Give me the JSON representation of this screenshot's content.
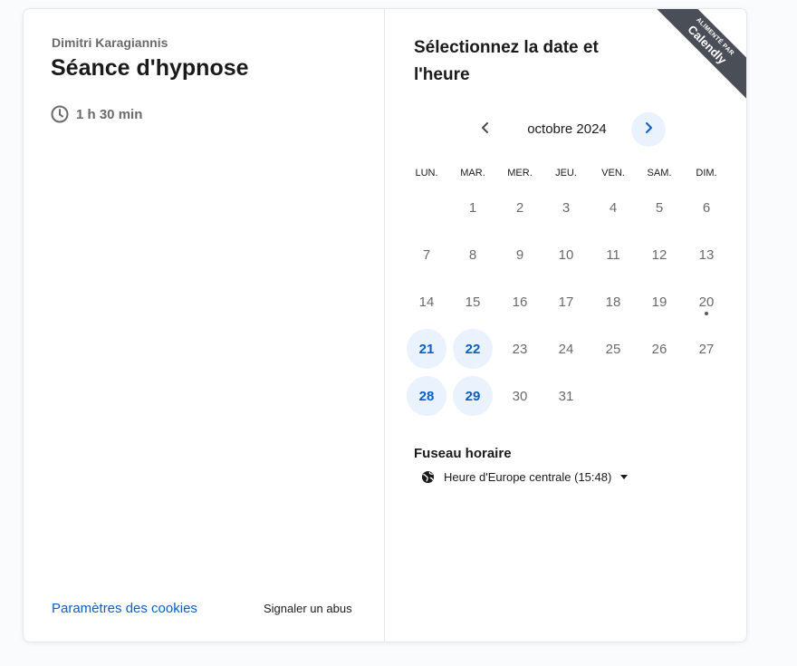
{
  "organizer": "Dimitri Karagiannis",
  "event_title": "Séance d'hypnose",
  "duration": "1 h 30 min",
  "footer": {
    "cookies": "Paramètres des cookies",
    "report": "Signaler un abus"
  },
  "picker": {
    "title": "Sélectionnez la date et l'heure",
    "month": "octobre 2024",
    "weekdays": [
      "LUN.",
      "MAR.",
      "MER.",
      "JEU.",
      "VEN.",
      "SAM.",
      "DIM."
    ],
    "days": [
      {
        "day": "1",
        "available": false
      },
      {
        "day": "2",
        "available": false
      },
      {
        "day": "3",
        "available": false
      },
      {
        "day": "4",
        "available": false
      },
      {
        "day": "5",
        "available": false
      },
      {
        "day": "6",
        "available": false
      },
      {
        "day": "7",
        "available": false
      },
      {
        "day": "8",
        "available": false
      },
      {
        "day": "9",
        "available": false
      },
      {
        "day": "10",
        "available": false
      },
      {
        "day": "11",
        "available": false
      },
      {
        "day": "12",
        "available": false
      },
      {
        "day": "13",
        "available": false
      },
      {
        "day": "14",
        "available": false
      },
      {
        "day": "15",
        "available": false
      },
      {
        "day": "16",
        "available": false
      },
      {
        "day": "17",
        "available": false
      },
      {
        "day": "18",
        "available": false
      },
      {
        "day": "19",
        "available": false
      },
      {
        "day": "20",
        "available": false,
        "today": true
      },
      {
        "day": "21",
        "available": true
      },
      {
        "day": "22",
        "available": true
      },
      {
        "day": "23",
        "available": false
      },
      {
        "day": "24",
        "available": false
      },
      {
        "day": "25",
        "available": false
      },
      {
        "day": "26",
        "available": false
      },
      {
        "day": "27",
        "available": false
      },
      {
        "day": "28",
        "available": true
      },
      {
        "day": "29",
        "available": true
      },
      {
        "day": "30",
        "available": false
      },
      {
        "day": "31",
        "available": false
      }
    ]
  },
  "timezone": {
    "title": "Fuseau horaire",
    "value": "Heure d'Europe centrale (15:48)"
  },
  "badge": {
    "line1": "ALIMENTÉ PAR",
    "brand": "Calendly"
  },
  "colors": {
    "accent": "#0b5dc7",
    "available_bg": "#e9f2fd",
    "badge_bg": "#4a4f57"
  },
  "icons": {
    "duration": "clock-icon",
    "prev": "chevron-left-icon",
    "next": "chevron-right-icon",
    "timezone": "globe-icon",
    "dropdown": "caret-down-icon"
  }
}
